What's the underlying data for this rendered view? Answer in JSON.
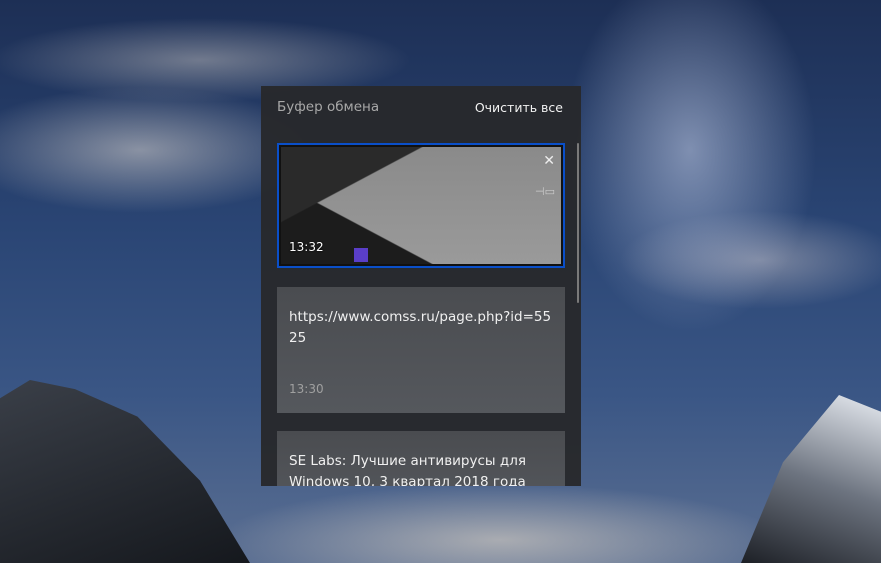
{
  "panel": {
    "title": "Буфер обмена",
    "clear_all": "Очистить все",
    "accent": "#0a4fc9",
    "items": [
      {
        "type": "image",
        "time": "13:32",
        "close_icon": "close-icon",
        "pin_icon": "pin-icon"
      },
      {
        "type": "text",
        "text": "https://www.comss.ru/page.php?id=5525",
        "time": "13:30"
      },
      {
        "type": "text",
        "text": "SE Labs: Лучшие антивирусы для Windows 10, 3 квартал 2018 года"
      }
    ]
  }
}
